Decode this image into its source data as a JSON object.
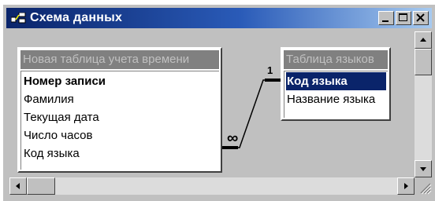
{
  "window": {
    "title": "Схема данных",
    "icon": "relationships-icon",
    "controls": [
      "minimize-icon",
      "maximize-icon",
      "close-icon"
    ]
  },
  "tables": [
    {
      "title": "Новая таблица учета времени",
      "fields": [
        {
          "label": "Номер записи",
          "primary_key": true
        },
        {
          "label": "Фамилия"
        },
        {
          "label": "Текущая дата"
        },
        {
          "label": "Число часов"
        },
        {
          "label": "Код языка"
        }
      ]
    },
    {
      "title": "Таблица языков",
      "fields": [
        {
          "label": "Код языка",
          "primary_key": true,
          "selected": true
        },
        {
          "label": "Название языка"
        }
      ]
    }
  ],
  "relationship": {
    "one_side_label": "1",
    "many_side_label": "∞"
  },
  "colors": {
    "title_bar_start": "#0a246a",
    "title_bar_end": "#a6caf0",
    "selection": "#0a246a",
    "face": "#c0c0c0"
  }
}
